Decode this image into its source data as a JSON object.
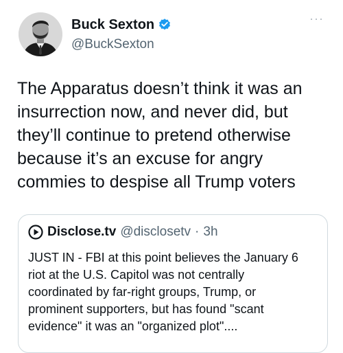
{
  "author": {
    "display_name": "Buck Sexton",
    "handle": "@BuckSexton",
    "avatar_icon": "user-avatar",
    "verified_icon": "verified-badge-icon",
    "verified_color": "#1d9bf0"
  },
  "more_icon": "more-options-icon",
  "tweet_text": "The Apparatus doesn’t think it was an\ninsurrection now, and never did, but\nthey’ll continue to pretend otherwise\nbecause it’s an excuse for angry\ncommies to despise all Trump voters",
  "quote": {
    "logo_icon": "play-logo-icon",
    "display_name": "Disclose.tv",
    "handle": "@disclosetv",
    "separator": "·",
    "time": "3h",
    "text": "JUST IN - FBI at this point believes the January 6\nriot at the U.S. Capitol was not centrally\ncoordinated by far-right groups, Trump, or\nprominent supporters, but has found \"scant\nevidence\" it was an \"organized plot\"...."
  }
}
